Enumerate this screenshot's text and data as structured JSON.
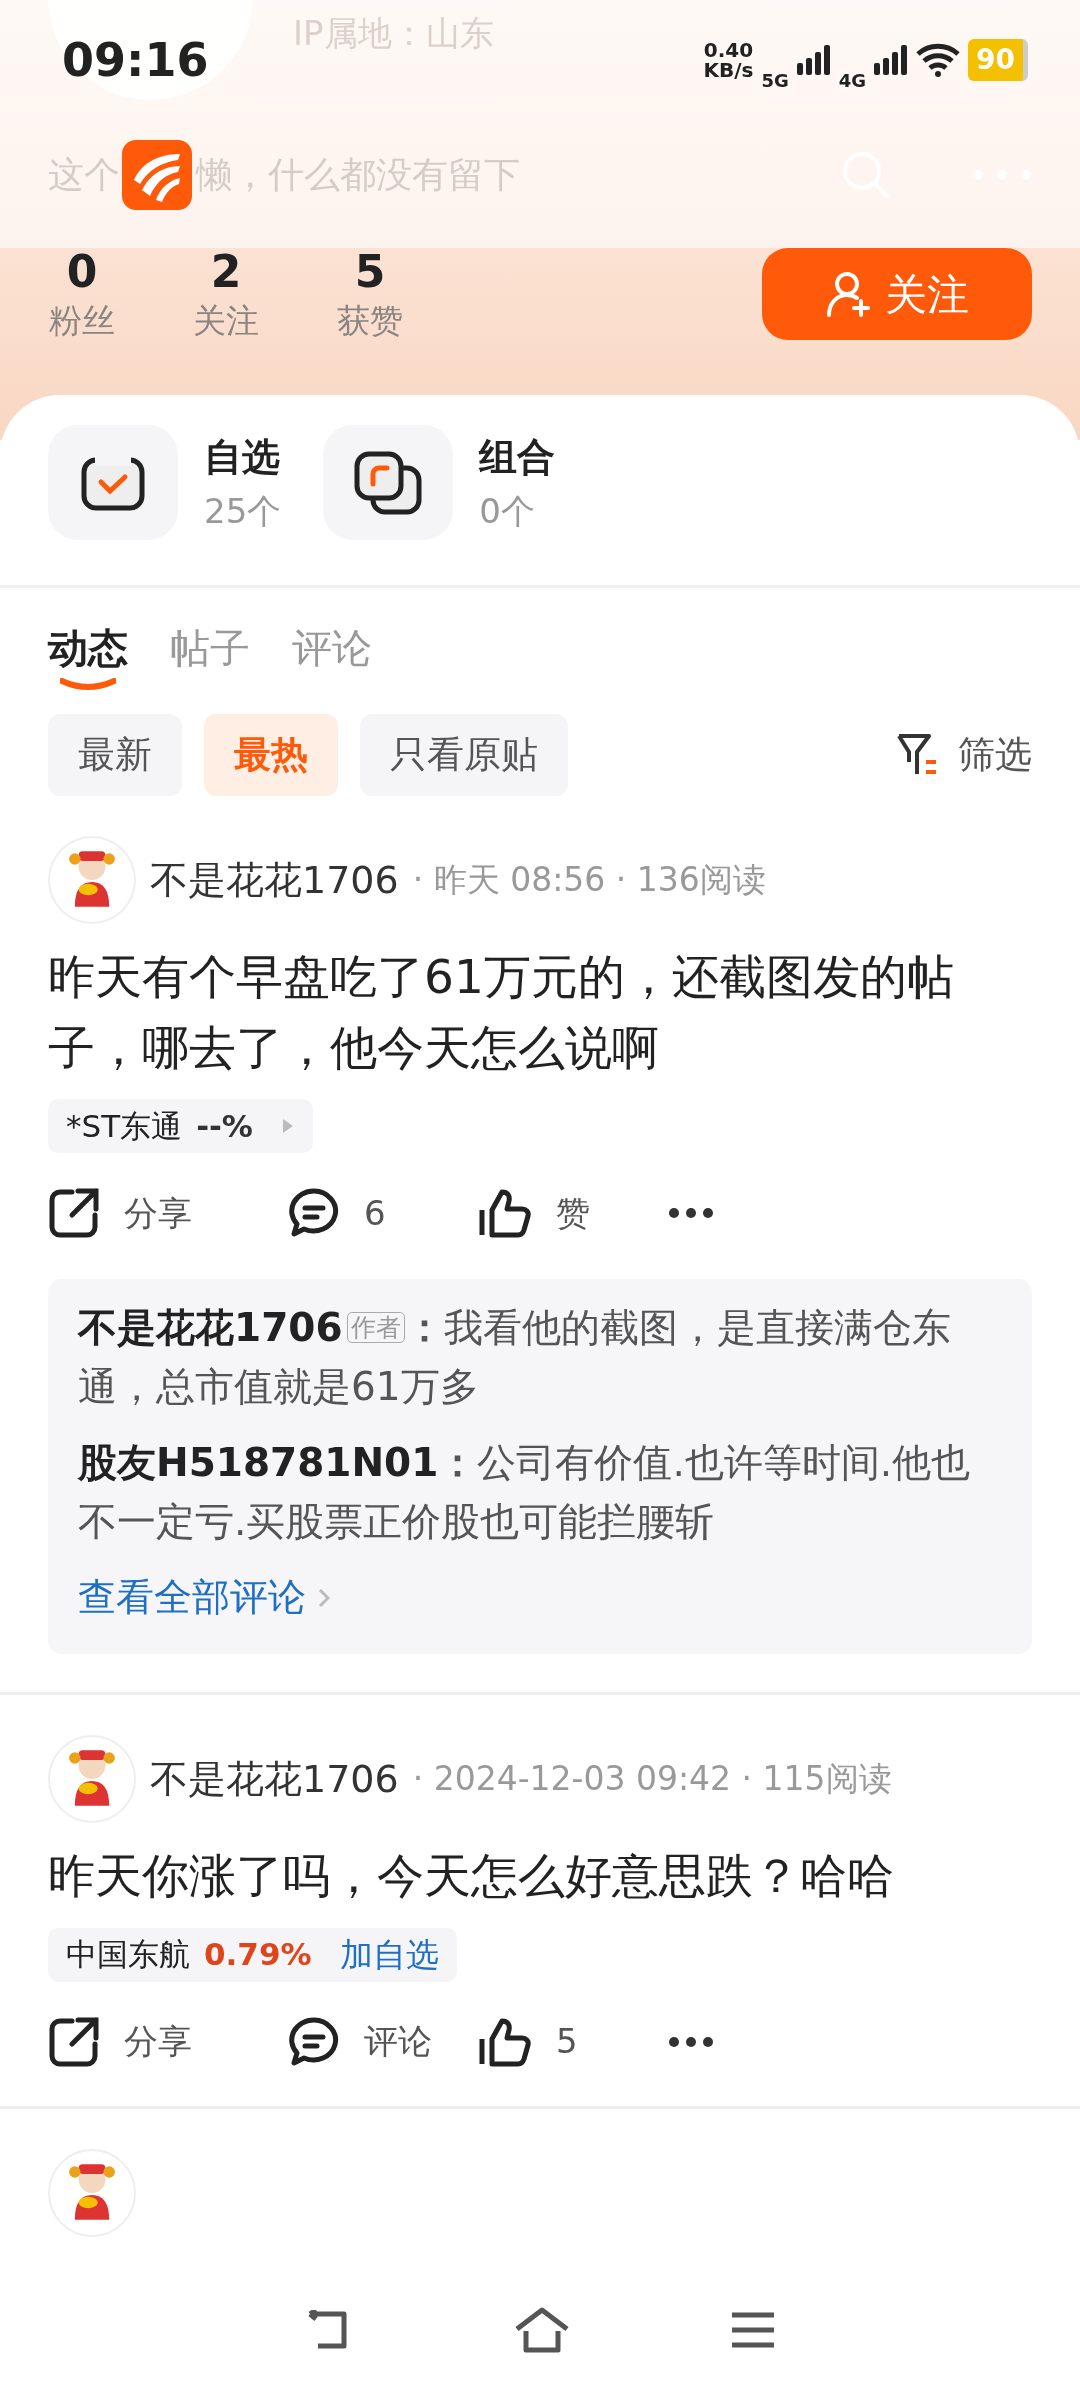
{
  "status_bar": {
    "time": "09:16",
    "net_speed": "0.40",
    "net_unit": "KB/s",
    "sim1": "5G",
    "sim2": "4G",
    "battery": "90"
  },
  "profile": {
    "ip_location": "IP属地：山东",
    "bio_before": "这个",
    "bio_after": "懒，什么都没有留下",
    "stats": [
      {
        "value": "0",
        "label": "粉丝"
      },
      {
        "value": "2",
        "label": "关注"
      },
      {
        "value": "5",
        "label": "获赞"
      }
    ],
    "follow_button": "关注"
  },
  "shortcuts": [
    {
      "kind": "watchlist",
      "title": "自选",
      "count": "25个"
    },
    {
      "kind": "portfolio",
      "title": "组合",
      "count": "0个"
    }
  ],
  "tabs": [
    {
      "label": "动态",
      "selected": true
    },
    {
      "label": "帖子",
      "selected": false
    },
    {
      "label": "评论",
      "selected": false
    }
  ],
  "filters": [
    {
      "label": "最新",
      "selected": false
    },
    {
      "label": "最热",
      "selected": true
    },
    {
      "label": "只看原贴",
      "selected": false
    }
  ],
  "filter_button": "筛选",
  "posts": [
    {
      "author": "不是花花1706",
      "meta": "· 昨天 08:56 · 136阅读",
      "body": "昨天有个早盘吃了61万元的，还截图发的帖子，哪去了，他今天怎么说啊",
      "stock": {
        "name": "*ST东通",
        "change": "--%",
        "rising": false,
        "kind": "arrow"
      },
      "actions": {
        "share": "分享",
        "comment": "6",
        "like": "赞"
      },
      "comments": [
        {
          "author": "不是花花1706",
          "badge": "作者",
          "text": "**：**我看他的截图，是直接满仓东通，总市值就是61万多"
        },
        {
          "author": "股友H518781N01",
          "text": "**：**公司有价值.也许等时间.他也不一定亏.买股票正价股也可能拦腰斩"
        }
      ],
      "view_all": "查看全部评论"
    },
    {
      "author": "不是花花1706",
      "meta": "· 2024-12-03 09:42 · 115阅读",
      "body": "昨天你涨了吗，今天怎么好意思跌？哈哈",
      "stock": {
        "name": "中国东航",
        "change": "0.79%",
        "rising": true,
        "kind": "add",
        "add_label": "加自选"
      },
      "actions": {
        "share": "分享",
        "comment": "评论",
        "like": "5"
      }
    }
  ]
}
